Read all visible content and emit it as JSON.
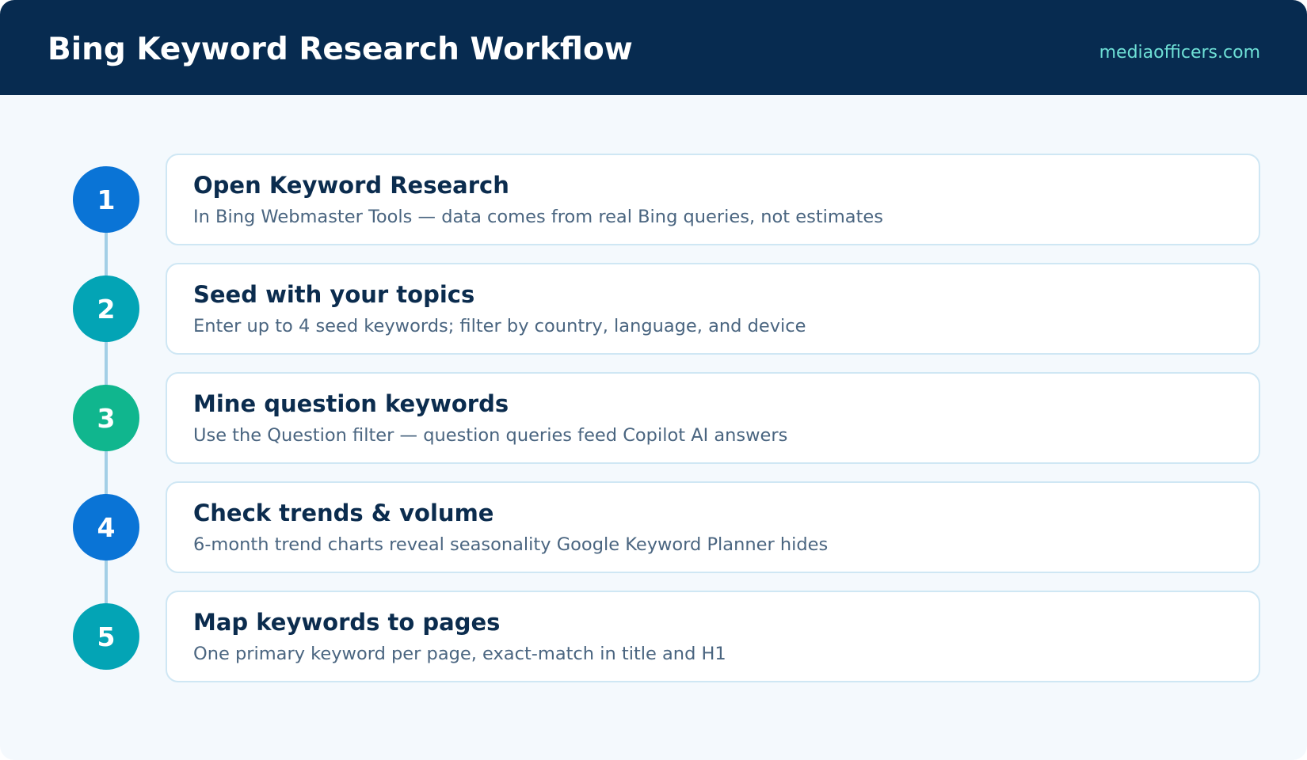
{
  "header": {
    "title": "Bing Keyword Research Workflow",
    "site": "mediaofficers.com"
  },
  "colors": {
    "header_bg": "#072b50",
    "page_bg": "#f4f9fd",
    "accent_blue": "#0a74d6",
    "accent_teal": "#03a4b5",
    "accent_green": "#10b68e",
    "site_text": "#6ee0d6"
  },
  "steps": [
    {
      "number": "1",
      "color": "#0a74d6",
      "title": "Open Keyword Research",
      "description": "In Bing Webmaster Tools — data comes from real Bing queries, not estimates"
    },
    {
      "number": "2",
      "color": "#03a4b5",
      "title": "Seed with your topics",
      "description": "Enter up to 4 seed keywords; filter by country, language, and device"
    },
    {
      "number": "3",
      "color": "#10b68e",
      "title": "Mine question keywords",
      "description": "Use the Question filter — question queries feed Copilot AI answers"
    },
    {
      "number": "4",
      "color": "#0a74d6",
      "title": "Check trends & volume",
      "description": "6-month trend charts reveal seasonality Google Keyword Planner hides"
    },
    {
      "number": "5",
      "color": "#03a4b5",
      "title": "Map keywords to pages",
      "description": "One primary keyword per page, exact-match in title and H1"
    }
  ]
}
